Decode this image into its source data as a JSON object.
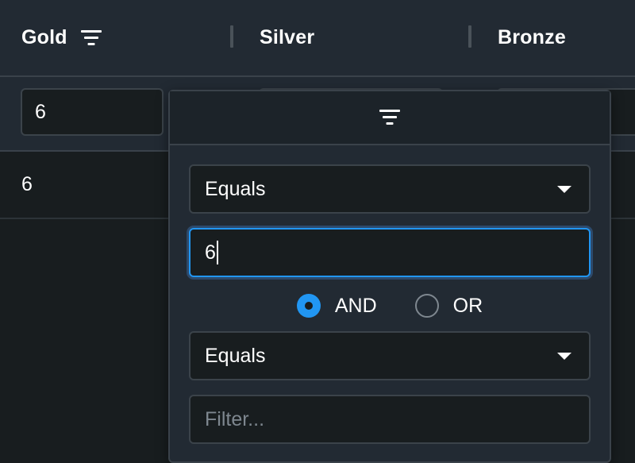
{
  "columns": [
    {
      "label": "Gold"
    },
    {
      "label": "Silver"
    },
    {
      "label": "Bronze"
    }
  ],
  "floating_filter": {
    "gold_value": "6"
  },
  "rows": [
    {
      "gold": "6"
    }
  ],
  "filter_popup": {
    "condition1": {
      "type": "Equals",
      "value": "6"
    },
    "join_options": {
      "and": "AND",
      "or": "OR",
      "selected": "AND"
    },
    "condition2": {
      "type": "Equals",
      "placeholder": "Filter..."
    }
  },
  "icons": {
    "column_menu": "filter-menu-icon",
    "dropdown": "triangle-down-icon"
  },
  "colors": {
    "background": "#181d1f",
    "header": "#222a33",
    "accent": "#2196f3",
    "border": "#3a424a"
  }
}
